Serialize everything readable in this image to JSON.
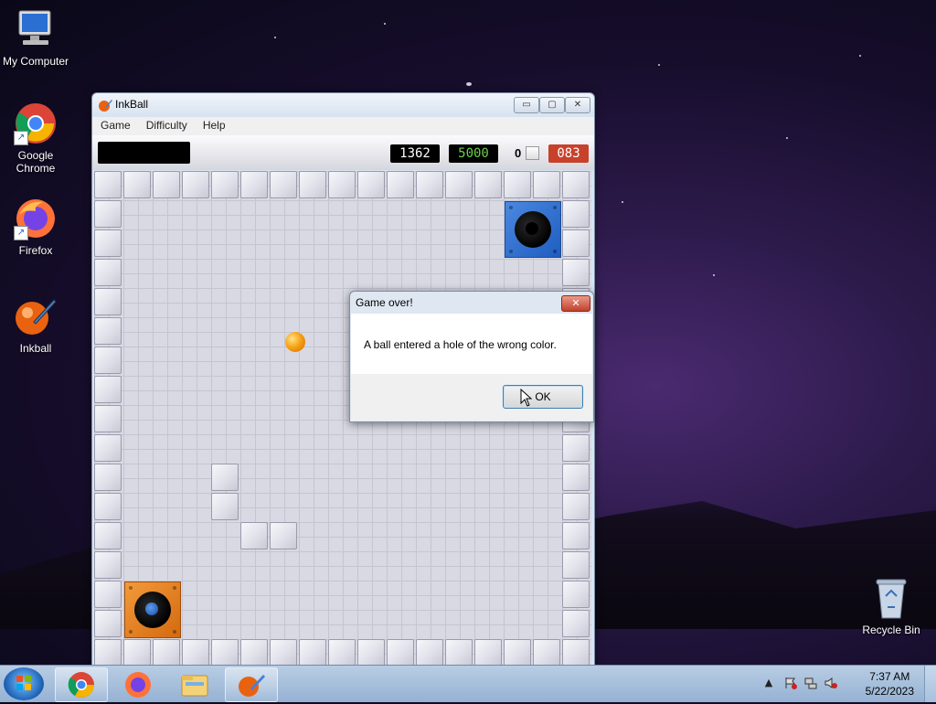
{
  "desktop": {
    "icons": [
      {
        "label": "My Computer",
        "icon": "computer-icon"
      },
      {
        "label": "Google Chrome",
        "icon": "chrome-icon"
      },
      {
        "label": "Firefox",
        "icon": "firefox-icon"
      },
      {
        "label": "Inkball",
        "icon": "inkball-icon"
      },
      {
        "label": "Recycle Bin",
        "icon": "recycle-bin-icon"
      }
    ]
  },
  "window": {
    "title": "InkBall",
    "menu": [
      "Game",
      "Difficulty",
      "Help"
    ],
    "controls": {
      "minimize": "▭",
      "maximize": "▢",
      "close": "✕"
    },
    "scores": {
      "current": "1362",
      "target": "5000",
      "balls_left": "0",
      "time": "083"
    }
  },
  "dialog": {
    "title": "Game over!",
    "message": "A ball entered a hole of the wrong color.",
    "ok_label": "OK",
    "close_label": "✕"
  },
  "taskbar": {
    "clock_time": "7:37 AM",
    "clock_date": "5/22/2023",
    "tray_arrow": "▲"
  },
  "colors": {
    "blue_hole": "#1f5dc0",
    "orange_hole": "#d46a10",
    "ball": "#f7a417",
    "score_red": "#c7412b",
    "score_green": "#6cd04a"
  }
}
